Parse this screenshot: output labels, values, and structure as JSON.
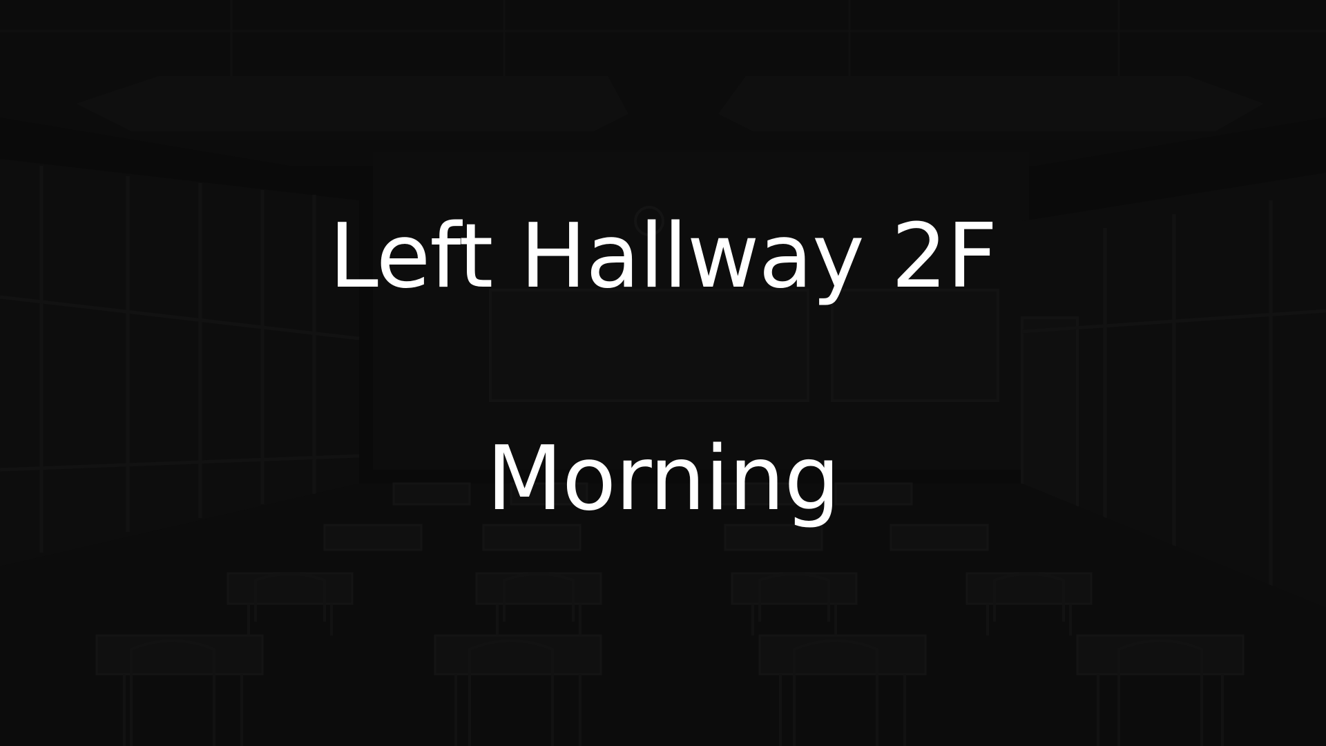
{
  "scene": {
    "location": "Left Hallway 2F",
    "time_of_day": "Morning",
    "background": "dimmed-classroom-interior",
    "colors": {
      "background": "#0d0d0d",
      "text": "#ffffff"
    }
  }
}
